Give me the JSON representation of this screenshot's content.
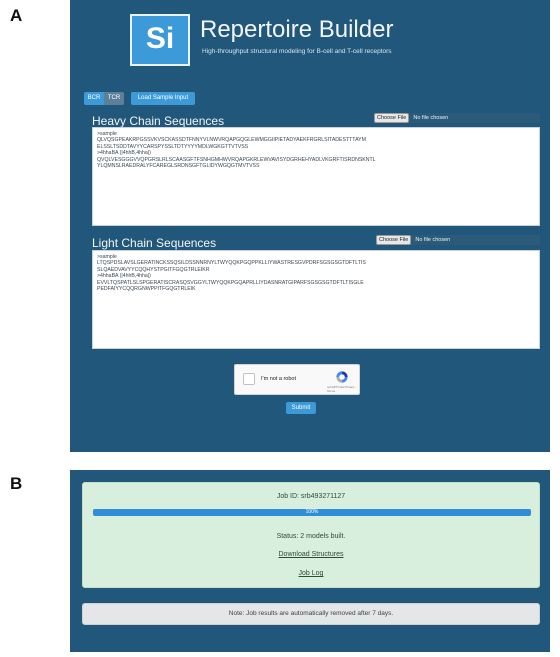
{
  "panels": {
    "a": "A",
    "b": "B"
  },
  "app": {
    "logo_text": "Si",
    "title": "Repertoire Builder",
    "subtitle": "High-throughput structural modeling for B-cell and T-cell receptors"
  },
  "mode_tabs": {
    "bcr": "BCR",
    "tcr": "TCR",
    "sample": "Load Sample Input"
  },
  "heavy": {
    "title": "Heavy Chain Sequences",
    "choose_label": "Choose File",
    "no_file": "No file chosen",
    "lines": [
      ">sample",
      "QLVQSGPEAKRPGSSVKVSCKASSDTFNNYVLNWVRQAPGQGLEWMGGIIPIETADYAEKFRGRLSITADESTTTAYM",
      "ELSSLTSDDTAVYYCARSPYSSLTDTYYYYMDLWGKGTTVTVSS",
      ">4hhaBA (|4hhB,4hha|)",
      "QVQLVESGGGVVQPGRSLRLSCAASGFTFSNHGMHWVRQAPGKRLEWVAVISYDGRHEHYADLVKGRFTISRDNSKNTL",
      "YLQMNSLRAEDRALYFCAREGLSRDNSGFTGLIDYWGQGTMVTVSS"
    ]
  },
  "light": {
    "title": "Light Chain Sequences",
    "choose_label": "Choose File",
    "no_file": "No file chosen",
    "lines": [
      ">sample",
      "LTQSPDSLAVSLGERATINCKSSQSILDSSNNRNYLTWYQQKPGQPPKLLIYWASTRESGVPDRFSGSGSGTDFTLTIS",
      "SLQAEDVAVYYCQQHYSTPGITFGQGTRLEIKR",
      ">4hhaBA (|4hhB,4hha|)",
      "EVVLTQSPATLSLSPGERATISCRASQSVGGYLTWYQQKPGQAPRLLIYDASNRATGIPARFSGSGSGTDFTLTISGLE",
      "PEDFAIYYCQQRGNWPPITFGQGTRLEIK"
    ]
  },
  "captcha": {
    "label": "I'm not a robot",
    "brand": "reCAPTCHA Privacy - Terms"
  },
  "submit_label": "Submit",
  "job": {
    "id_text": "Job ID: srb493271127",
    "progress_text": "100%",
    "progress_value": 1.0,
    "status_text": "Status: 2 models built.",
    "download_label": "Download Structures",
    "log_label": "Job Log"
  },
  "note": "Note: Job results are automatically removed after 7 days.",
  "colors": {
    "panel_bg": "#21577a",
    "accent": "#3c9ad8",
    "success_bg": "#d7efdc"
  }
}
